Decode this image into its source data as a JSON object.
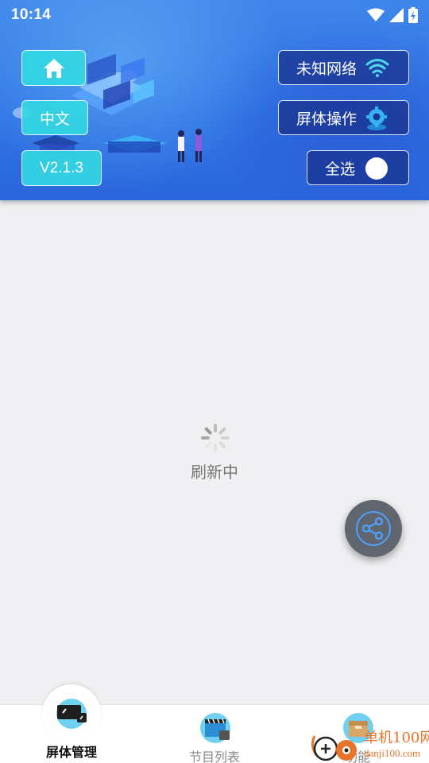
{
  "status_bar": {
    "time": "10:14"
  },
  "header": {
    "language_label": "中文",
    "version_label": "V2.1.3",
    "network_label": "未知网络",
    "screen_operation_label": "屏体操作",
    "select_all_label": "全选"
  },
  "main": {
    "loading_text": "刷新中"
  },
  "bottom_nav": {
    "items": [
      {
        "label": "屏体管理"
      },
      {
        "label": "节目列表"
      },
      {
        "label": "功能"
      }
    ]
  },
  "watermark": {
    "line1": "单机100网",
    "line2": "danji100.com"
  },
  "colors": {
    "header_blue": "#2f74e4",
    "button_cyan": "#33d6e2",
    "button_navy": "#17308c",
    "fab_gray": "#60666f"
  }
}
